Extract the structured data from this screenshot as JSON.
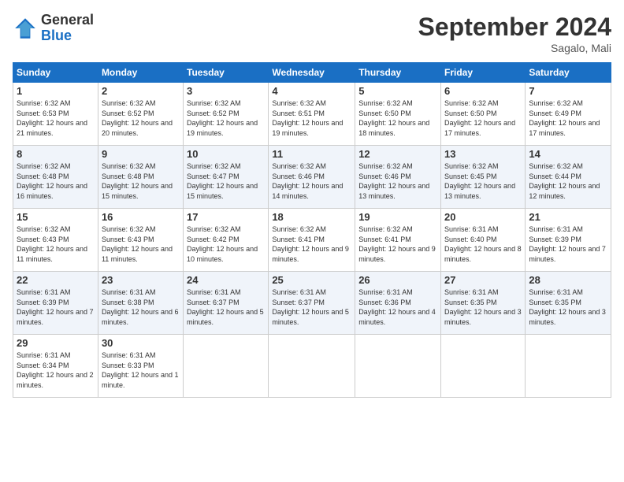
{
  "logo": {
    "general": "General",
    "blue": "Blue"
  },
  "header": {
    "month": "September 2024",
    "location": "Sagalo, Mali"
  },
  "days_of_week": [
    "Sunday",
    "Monday",
    "Tuesday",
    "Wednesday",
    "Thursday",
    "Friday",
    "Saturday"
  ],
  "weeks": [
    [
      {
        "day": "1",
        "sunrise": "6:32 AM",
        "sunset": "6:53 PM",
        "daylight": "12 hours and 21 minutes."
      },
      {
        "day": "2",
        "sunrise": "6:32 AM",
        "sunset": "6:52 PM",
        "daylight": "12 hours and 20 minutes."
      },
      {
        "day": "3",
        "sunrise": "6:32 AM",
        "sunset": "6:52 PM",
        "daylight": "12 hours and 19 minutes."
      },
      {
        "day": "4",
        "sunrise": "6:32 AM",
        "sunset": "6:51 PM",
        "daylight": "12 hours and 19 minutes."
      },
      {
        "day": "5",
        "sunrise": "6:32 AM",
        "sunset": "6:50 PM",
        "daylight": "12 hours and 18 minutes."
      },
      {
        "day": "6",
        "sunrise": "6:32 AM",
        "sunset": "6:50 PM",
        "daylight": "12 hours and 17 minutes."
      },
      {
        "day": "7",
        "sunrise": "6:32 AM",
        "sunset": "6:49 PM",
        "daylight": "12 hours and 17 minutes."
      }
    ],
    [
      {
        "day": "8",
        "sunrise": "6:32 AM",
        "sunset": "6:48 PM",
        "daylight": "12 hours and 16 minutes."
      },
      {
        "day": "9",
        "sunrise": "6:32 AM",
        "sunset": "6:48 PM",
        "daylight": "12 hours and 15 minutes."
      },
      {
        "day": "10",
        "sunrise": "6:32 AM",
        "sunset": "6:47 PM",
        "daylight": "12 hours and 15 minutes."
      },
      {
        "day": "11",
        "sunrise": "6:32 AM",
        "sunset": "6:46 PM",
        "daylight": "12 hours and 14 minutes."
      },
      {
        "day": "12",
        "sunrise": "6:32 AM",
        "sunset": "6:46 PM",
        "daylight": "12 hours and 13 minutes."
      },
      {
        "day": "13",
        "sunrise": "6:32 AM",
        "sunset": "6:45 PM",
        "daylight": "12 hours and 13 minutes."
      },
      {
        "day": "14",
        "sunrise": "6:32 AM",
        "sunset": "6:44 PM",
        "daylight": "12 hours and 12 minutes."
      }
    ],
    [
      {
        "day": "15",
        "sunrise": "6:32 AM",
        "sunset": "6:43 PM",
        "daylight": "12 hours and 11 minutes."
      },
      {
        "day": "16",
        "sunrise": "6:32 AM",
        "sunset": "6:43 PM",
        "daylight": "12 hours and 11 minutes."
      },
      {
        "day": "17",
        "sunrise": "6:32 AM",
        "sunset": "6:42 PM",
        "daylight": "12 hours and 10 minutes."
      },
      {
        "day": "18",
        "sunrise": "6:32 AM",
        "sunset": "6:41 PM",
        "daylight": "12 hours and 9 minutes."
      },
      {
        "day": "19",
        "sunrise": "6:32 AM",
        "sunset": "6:41 PM",
        "daylight": "12 hours and 9 minutes."
      },
      {
        "day": "20",
        "sunrise": "6:31 AM",
        "sunset": "6:40 PM",
        "daylight": "12 hours and 8 minutes."
      },
      {
        "day": "21",
        "sunrise": "6:31 AM",
        "sunset": "6:39 PM",
        "daylight": "12 hours and 7 minutes."
      }
    ],
    [
      {
        "day": "22",
        "sunrise": "6:31 AM",
        "sunset": "6:39 PM",
        "daylight": "12 hours and 7 minutes."
      },
      {
        "day": "23",
        "sunrise": "6:31 AM",
        "sunset": "6:38 PM",
        "daylight": "12 hours and 6 minutes."
      },
      {
        "day": "24",
        "sunrise": "6:31 AM",
        "sunset": "6:37 PM",
        "daylight": "12 hours and 5 minutes."
      },
      {
        "day": "25",
        "sunrise": "6:31 AM",
        "sunset": "6:37 PM",
        "daylight": "12 hours and 5 minutes."
      },
      {
        "day": "26",
        "sunrise": "6:31 AM",
        "sunset": "6:36 PM",
        "daylight": "12 hours and 4 minutes."
      },
      {
        "day": "27",
        "sunrise": "6:31 AM",
        "sunset": "6:35 PM",
        "daylight": "12 hours and 3 minutes."
      },
      {
        "day": "28",
        "sunrise": "6:31 AM",
        "sunset": "6:35 PM",
        "daylight": "12 hours and 3 minutes."
      }
    ],
    [
      {
        "day": "29",
        "sunrise": "6:31 AM",
        "sunset": "6:34 PM",
        "daylight": "12 hours and 2 minutes."
      },
      {
        "day": "30",
        "sunrise": "6:31 AM",
        "sunset": "6:33 PM",
        "daylight": "12 hours and 1 minute."
      },
      null,
      null,
      null,
      null,
      null
    ]
  ]
}
